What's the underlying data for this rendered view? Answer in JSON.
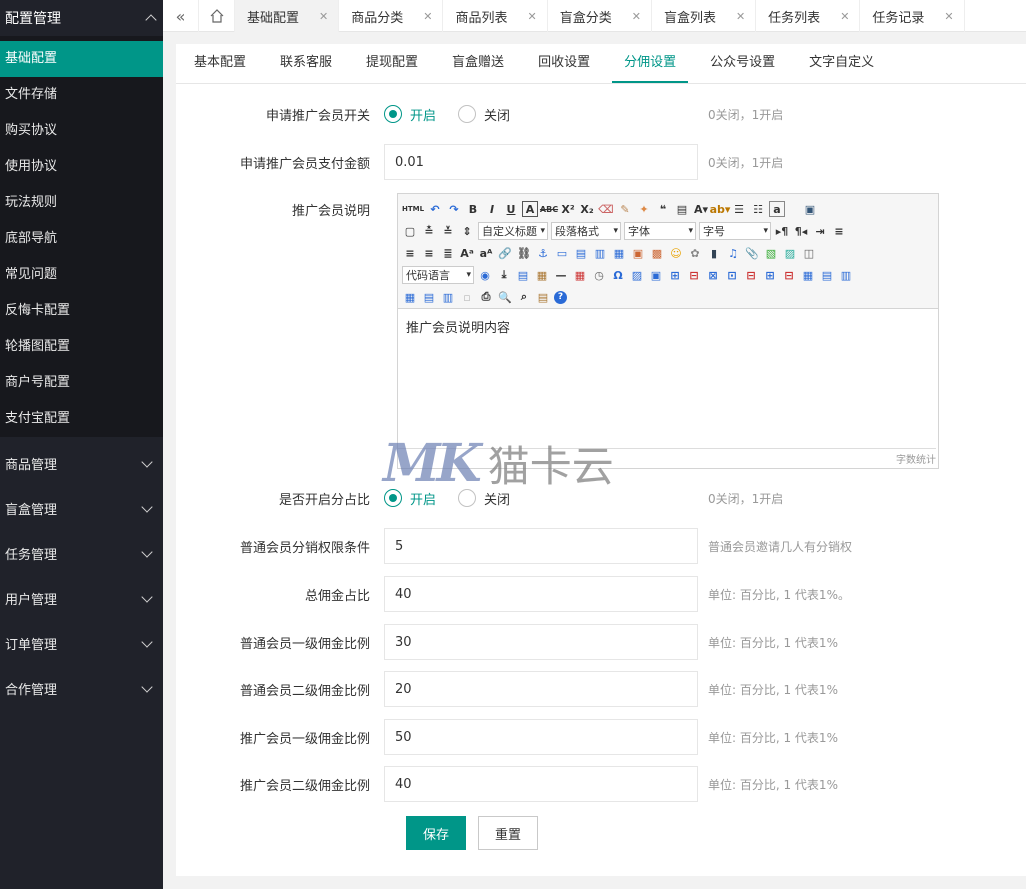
{
  "sidebar": {
    "header": "配置管理",
    "items": [
      "基础配置",
      "文件存储",
      "购买协议",
      "使用协议",
      "玩法规则",
      "底部导航",
      "常见问题",
      "反悔卡配置",
      "轮播图配置",
      "商户号配置",
      "支付宝配置"
    ],
    "groups": [
      "商品管理",
      "盲盒管理",
      "任务管理",
      "用户管理",
      "订单管理",
      "合作管理"
    ]
  },
  "tabs": [
    "基础配置",
    "商品分类",
    "商品列表",
    "盲盒分类",
    "盲盒列表",
    "任务列表",
    "任务记录"
  ],
  "subtabs": [
    "基本配置",
    "联系客服",
    "提现配置",
    "盲盒赠送",
    "回收设置",
    "分佣设置",
    "公众号设置",
    "文字自定义"
  ],
  "form": {
    "apply_switch": {
      "label": "申请推广会员开关",
      "on": "开启",
      "off": "关闭",
      "hint": "0关闭，1开启"
    },
    "apply_amount": {
      "label": "申请推广会员支付金额",
      "value": "0.01",
      "hint": "0关闭，1开启"
    },
    "desc": {
      "label": "推广会员说明",
      "content": "推广会员说明内容",
      "counter": "字数统计"
    },
    "ratio_switch": {
      "label": "是否开启分占比",
      "on": "开启",
      "off": "关闭",
      "hint": "0关闭，1开启"
    },
    "fields": [
      {
        "label": "普通会员分销权限条件",
        "value": "5",
        "hint": "普通会员邀请几人有分销权"
      },
      {
        "label": "总佣金占比",
        "value": "40",
        "hint": "单位: 百分比, 1 代表1%。"
      },
      {
        "label": "普通会员一级佣金比例",
        "value": "30",
        "hint": "单位: 百分比, 1 代表1%"
      },
      {
        "label": "普通会员二级佣金比例",
        "value": "20",
        "hint": "单位: 百分比, 1 代表1%"
      },
      {
        "label": "推广会员一级佣金比例",
        "value": "50",
        "hint": "单位: 百分比, 1 代表1%"
      },
      {
        "label": "推广会员二级佣金比例",
        "value": "40",
        "hint": "单位: 百分比, 1 代表1%"
      }
    ],
    "save": "保存",
    "reset": "重置"
  },
  "editor_toolbar": {
    "heading": "自定义标题",
    "paragraph": "段落格式",
    "font": "字体",
    "size": "字号",
    "code": "代码语言",
    "html": "HTML"
  },
  "watermark": {
    "logo": "MK",
    "text": "猫卡云"
  },
  "colors": {
    "accent": "#009688",
    "sidebar": "#20222a"
  }
}
